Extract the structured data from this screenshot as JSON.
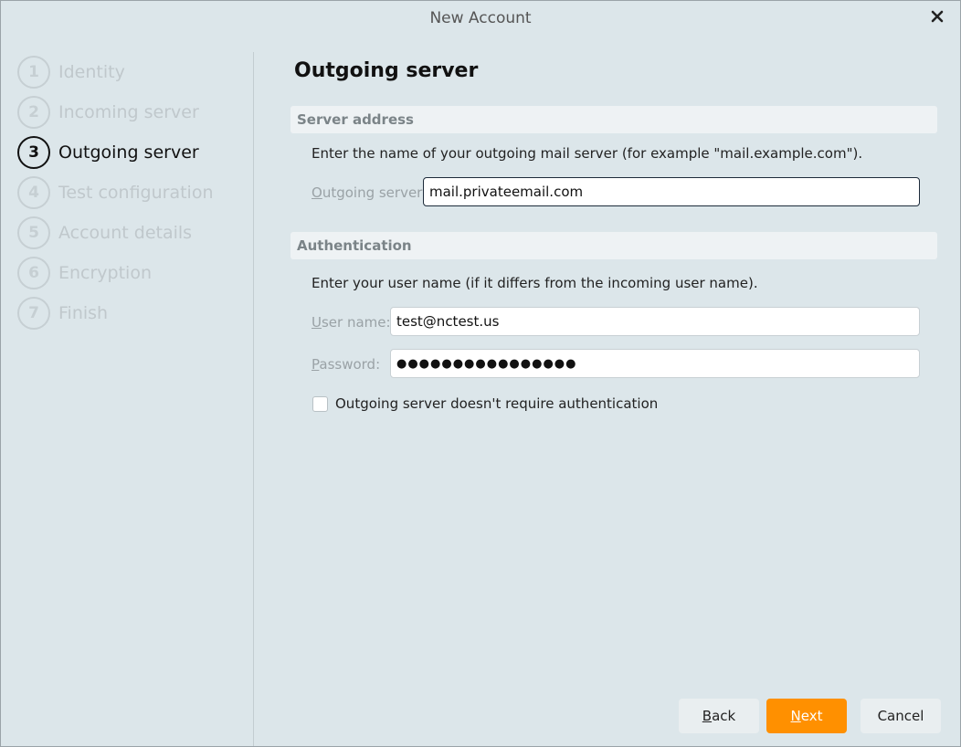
{
  "window": {
    "title": "New Account",
    "close_icon": "close-icon"
  },
  "steps": [
    {
      "num": "1",
      "label": "Identity",
      "active": false
    },
    {
      "num": "2",
      "label": "Incoming server",
      "active": false
    },
    {
      "num": "3",
      "label": "Outgoing server",
      "active": true
    },
    {
      "num": "4",
      "label": "Test configuration",
      "active": false
    },
    {
      "num": "5",
      "label": "Account details",
      "active": false
    },
    {
      "num": "6",
      "label": "Encryption",
      "active": false
    },
    {
      "num": "7",
      "label": "Finish",
      "active": false
    }
  ],
  "page": {
    "title": "Outgoing server"
  },
  "server_section": {
    "header": "Server address",
    "description": "Enter the name of your outgoing mail server (for example \"mail.example.com\").",
    "label_accel": "O",
    "label_rest": "utgoing server:",
    "value": "mail.privateemail.com"
  },
  "auth_section": {
    "header": "Authentication",
    "description": "Enter your user name (if it differs from the incoming user name).",
    "user_label_accel": "U",
    "user_label_rest": "ser name:",
    "user_value": "test@nctest.us",
    "password_label_accel": "P",
    "password_label_rest": "assword:",
    "password_value": "●●●●●●●●●●●●●●●●",
    "no_auth_checkbox_label": "Outgoing server doesn't require authentication",
    "no_auth_checked": false
  },
  "buttons": {
    "back_accel": "B",
    "back_rest": "ack",
    "next_accel": "N",
    "next_rest": "ext",
    "cancel": "Cancel"
  },
  "colors": {
    "accent": "#ff9000",
    "background": "#dce6ea",
    "active_step": "#111111",
    "inactive_step": "#c0c8cc"
  }
}
